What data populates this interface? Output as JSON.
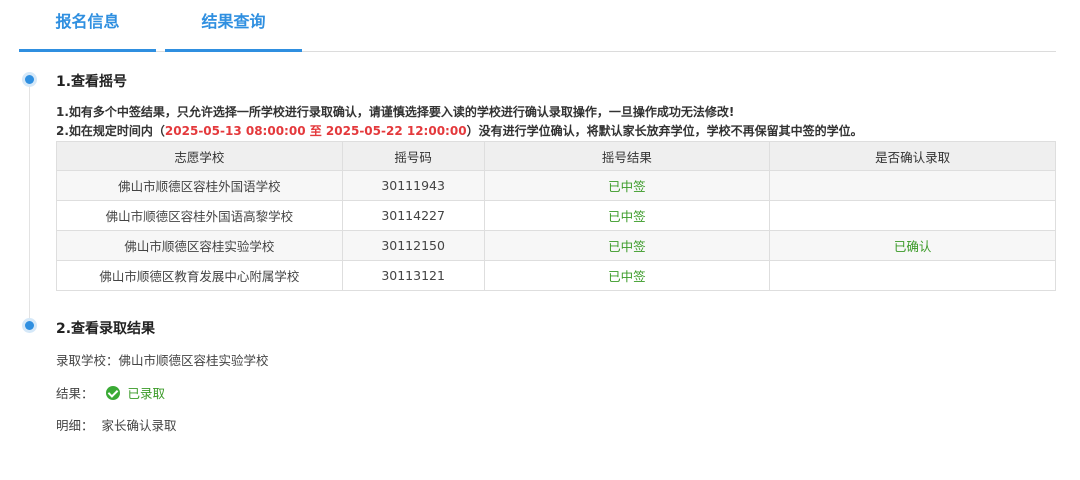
{
  "tabs": [
    {
      "label": "报名信息"
    },
    {
      "label": "结果查询"
    }
  ],
  "section1": {
    "title": "1.查看摇号",
    "notice1": "1.如有多个中签结果，只允许选择一所学校进行录取确认，请谨慎选择要入读的学校进行确认录取操作，一旦操作成功无法修改!",
    "notice2_prefix": "2.如在规定时间内（",
    "notice2_start": "2025-05-13 08:00:00",
    "notice2_to": " 至 ",
    "notice2_end": "2025-05-22 12:00:00",
    "notice2_suffix": "）没有进行学位确认，将默认家长放弃学位，学校不再保留其中签的学位。"
  },
  "table": {
    "headers": [
      "志愿学校",
      "摇号码",
      "摇号结果",
      "是否确认录取"
    ],
    "rows": [
      {
        "school": "佛山市顺德区容桂外国语学校",
        "code": "30111943",
        "result": "已中签",
        "confirm": ""
      },
      {
        "school": "佛山市顺德区容桂外国语高黎学校",
        "code": "30114227",
        "result": "已中签",
        "confirm": ""
      },
      {
        "school": "佛山市顺德区容桂实验学校",
        "code": "30112150",
        "result": "已中签",
        "confirm": "已确认"
      },
      {
        "school": "佛山市顺德区教育发展中心附属学校",
        "code": "30113121",
        "result": "已中签",
        "confirm": ""
      }
    ]
  },
  "section2": {
    "title": "2.查看录取结果",
    "school_label": "录取学校：",
    "school_value": "佛山市顺德区容桂实验学校",
    "result_label": "结果：",
    "result_value": "已录取",
    "detail_label": "明细：",
    "detail_value": "家长确认录取"
  },
  "colors": {
    "accent": "#2f8fe0",
    "success": "#3a9a27",
    "warning": "#e4393c"
  }
}
